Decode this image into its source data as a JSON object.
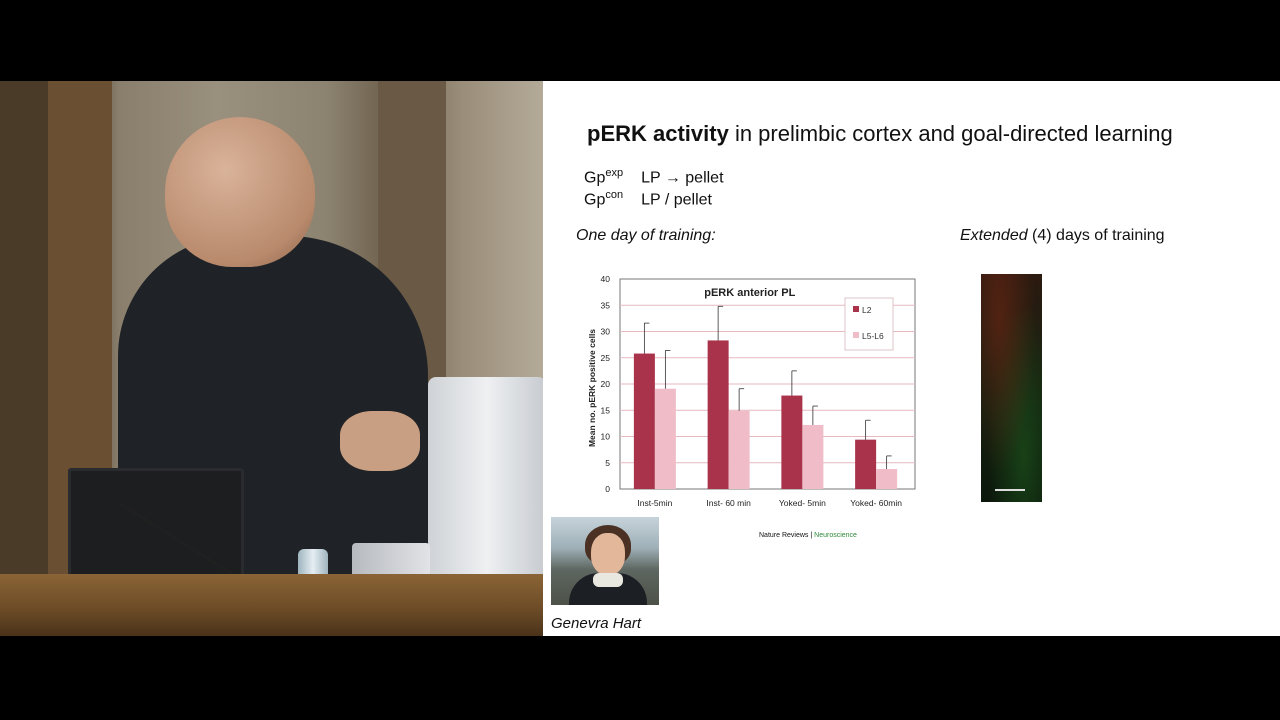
{
  "slide": {
    "title_bold": "pERK activity",
    "title_rest": " in prelimbic cortex and goal-directed learning",
    "groups": [
      {
        "base": "Gp",
        "sup": "exp",
        "text": "LP → pellet"
      },
      {
        "base": "Gp",
        "sup": "con",
        "text": "LP / pellet"
      }
    ],
    "subtitle_left": "One day of training:",
    "subtitle_right_italic": "Extended",
    "subtitle_right_rest": " (4) days of training",
    "caption": "Genevra Hart",
    "journal_name": "Nature Reviews",
    "journal_separator": " | ",
    "journal_section": "Neuroscience"
  },
  "chart_data": {
    "type": "bar",
    "title": "pERK anterior PL",
    "ylabel": "Mean no. pERK positive cells",
    "xlabel": "",
    "ylim": [
      0,
      40
    ],
    "yticks": [
      0,
      5,
      10,
      15,
      20,
      25,
      30,
      35,
      40
    ],
    "categories": [
      "Inst-5min",
      "Inst- 60 min",
      "Yoked- 5min",
      "Yoked- 60min"
    ],
    "series": [
      {
        "name": "L2",
        "color": "#a8334a",
        "values": [
          25.8,
          28.3,
          17.8,
          9.4
        ],
        "errors": [
          5.8,
          6.5,
          4.7,
          3.7
        ]
      },
      {
        "name": "L5-L6",
        "color": "#f0bcc8",
        "values": [
          19.1,
          14.9,
          12.2,
          3.8
        ],
        "errors": [
          7.3,
          4.2,
          3.6,
          2.5
        ]
      }
    ],
    "grid": true,
    "legend": "top-right"
  }
}
